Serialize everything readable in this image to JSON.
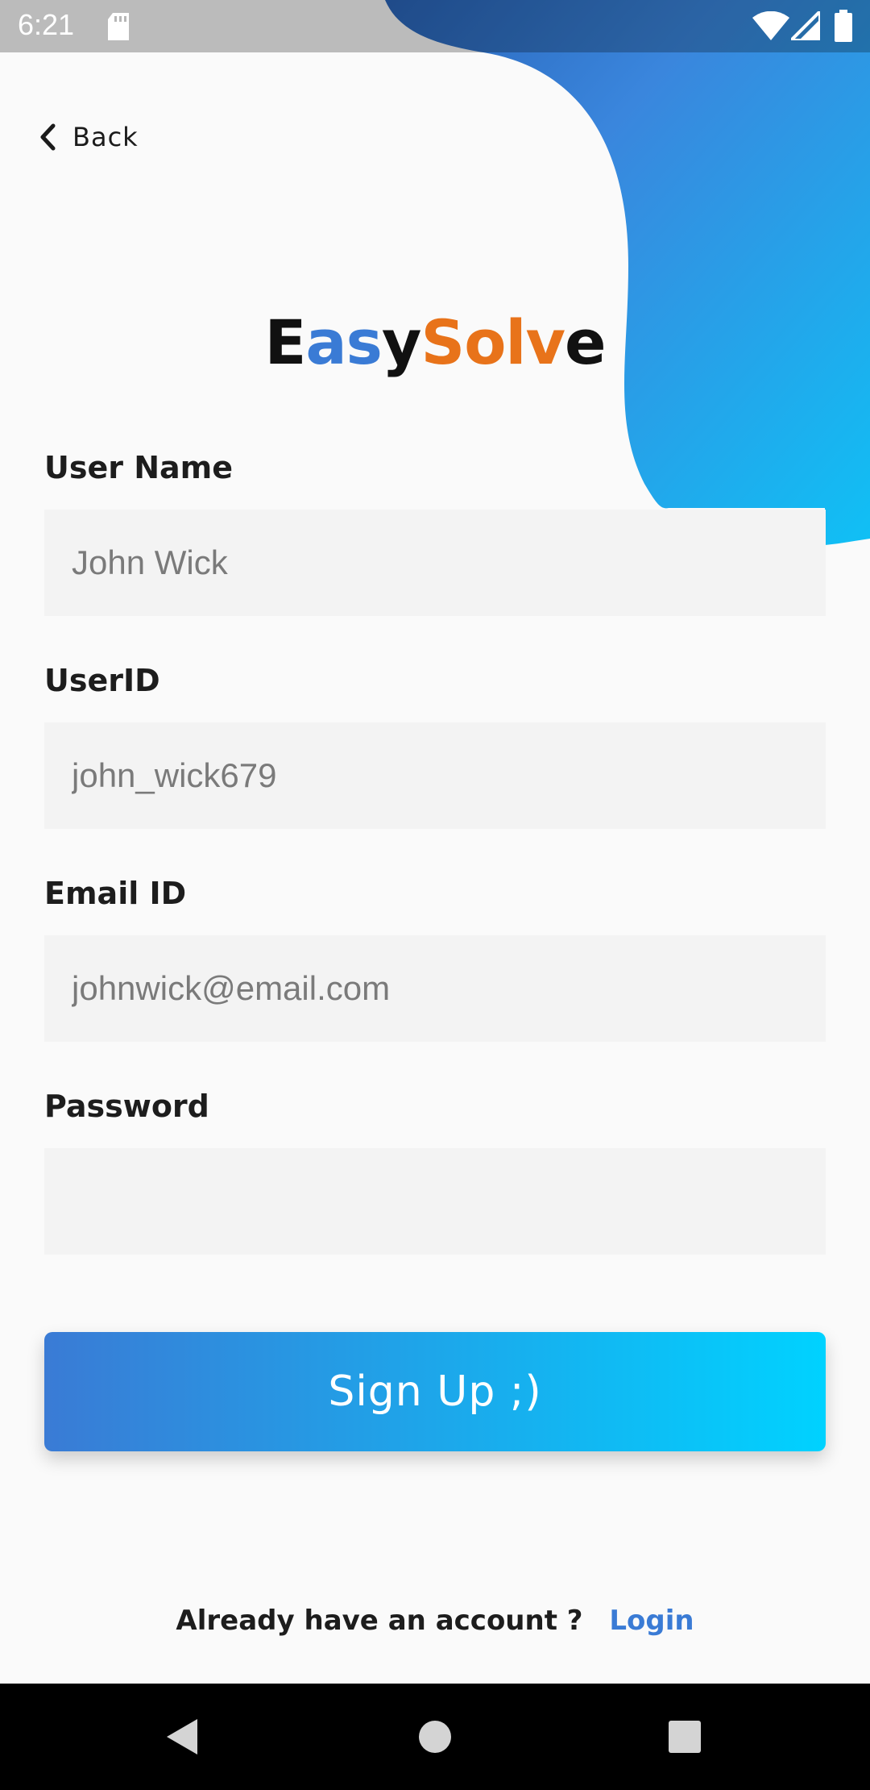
{
  "status_bar": {
    "time": "6:21",
    "icons": [
      "sd-card-icon",
      "wifi-icon",
      "cell-signal-icon",
      "battery-icon"
    ]
  },
  "colors": {
    "gradient_start": "#3a7bd5",
    "gradient_end": "#00d2ff",
    "logo_dark": "#111111",
    "logo_blue": "#3a7bd5",
    "logo_orange": "#e8731a",
    "input_bg": "#f3f3f3",
    "link": "#3a7bd5"
  },
  "header": {
    "back_label": "Back"
  },
  "logo": {
    "parts": [
      {
        "text": "E",
        "color": "#111111"
      },
      {
        "text": "as",
        "color": "#3a7bd5"
      },
      {
        "text": "y",
        "color": "#111111"
      },
      {
        "text": "S",
        "color": "#e8731a"
      },
      {
        "text": "ol",
        "color": "#e8731a"
      },
      {
        "text": "v",
        "color": "#e8731a"
      },
      {
        "text": "e",
        "color": "#111111"
      }
    ]
  },
  "form": {
    "user_name_label": "User Name",
    "user_name_placeholder": "John Wick",
    "user_id_label": "UserID",
    "user_id_placeholder": "john_wick679",
    "email_label": "Email ID",
    "email_placeholder": "johnwick@email.com",
    "password_label": "Password",
    "password_placeholder": "",
    "signup_label": "Sign Up ;)"
  },
  "footer": {
    "text": "Already have an account ?",
    "login_label": "Login"
  },
  "nav_bar": {
    "icons": [
      "back-triangle-icon",
      "home-circle-icon",
      "recents-square-icon"
    ]
  }
}
